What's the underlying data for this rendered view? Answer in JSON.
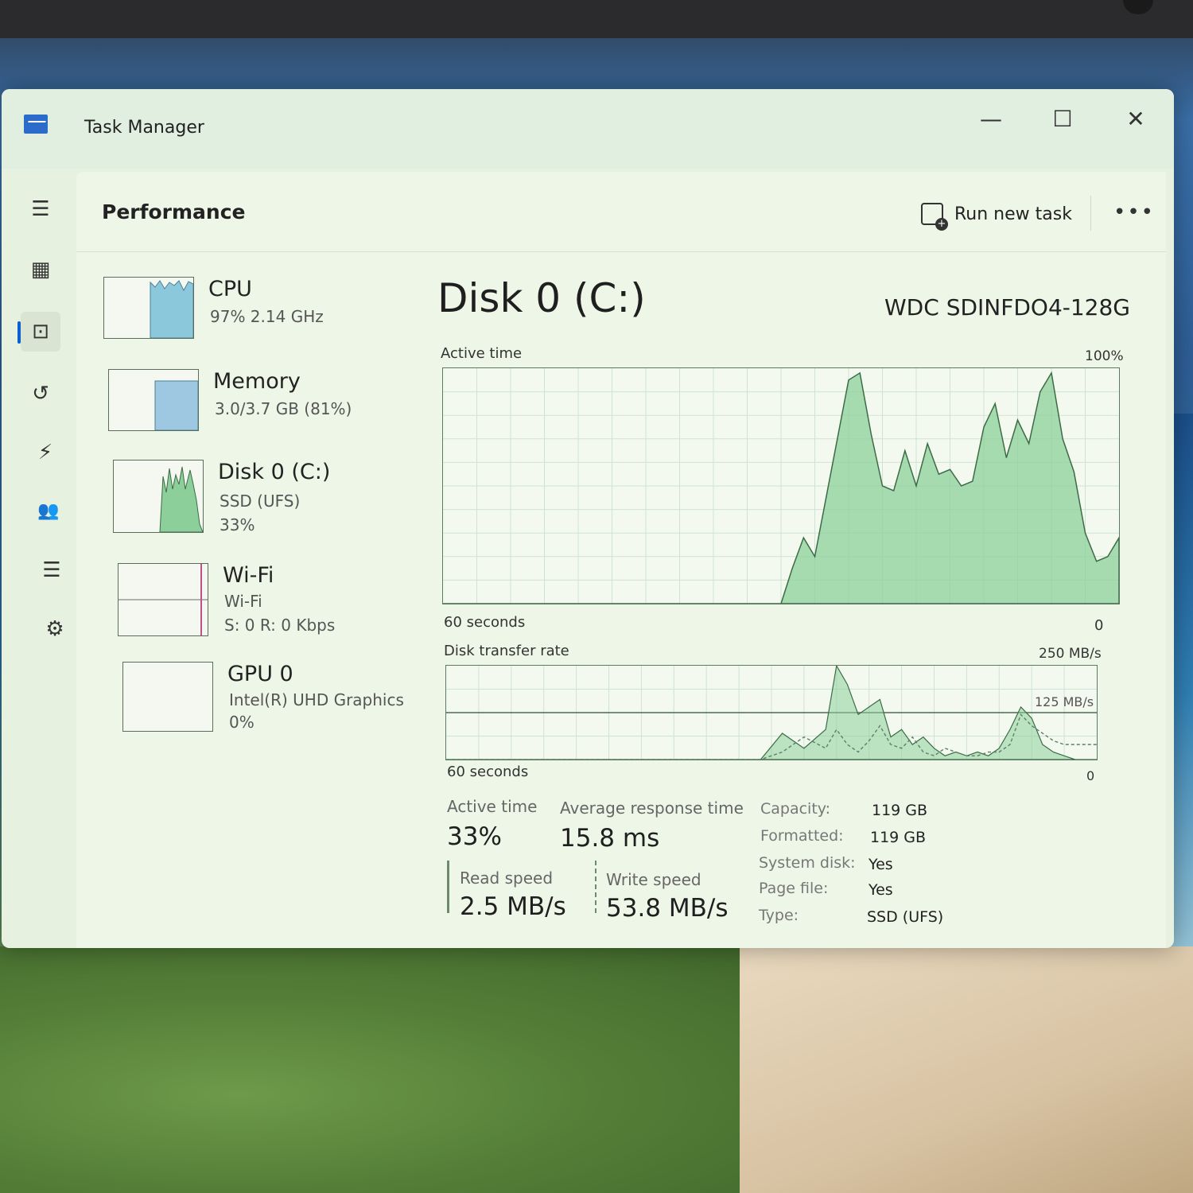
{
  "window": {
    "title": "Task Manager",
    "minimize": "—",
    "maximize": "☐",
    "close": "✕"
  },
  "nav": [
    {
      "name": "hamburger-menu-icon",
      "glyph": "☰"
    },
    {
      "name": "processes-icon",
      "glyph": "▦"
    },
    {
      "name": "performance-icon",
      "glyph": "⊡"
    },
    {
      "name": "app-history-icon",
      "glyph": "↺"
    },
    {
      "name": "startup-apps-icon",
      "glyph": "⚡"
    },
    {
      "name": "users-icon",
      "glyph": "👥"
    },
    {
      "name": "details-icon",
      "glyph": "☰"
    },
    {
      "name": "services-icon",
      "glyph": "⚙"
    }
  ],
  "header": {
    "title": "Performance",
    "run_task": "Run new task",
    "more": "•••"
  },
  "devices": [
    {
      "name": "CPU",
      "line1": "97%  2.14 GHz",
      "line2": "",
      "usage": 0.97
    },
    {
      "name": "Memory",
      "line1": "3.0/3.7 GB (81%)",
      "line2": "",
      "usage": 0.81
    },
    {
      "name": "Disk 0 (C:)",
      "line1": "SSD (UFS)",
      "line2": "33%",
      "usage": 0.33
    },
    {
      "name": "Wi-Fi",
      "line1": "Wi-Fi",
      "line2": "S: 0  R: 0 Kbps",
      "usage": 0
    },
    {
      "name": "GPU 0",
      "line1": "Intel(R) UHD Graphics",
      "line2": "0%",
      "usage": 0
    }
  ],
  "detail": {
    "title": "Disk 0 (C:)",
    "model": "WDC SDINFDO4-128G",
    "active_label": "Active time",
    "active_max": "100%",
    "active_left": "60 seconds",
    "active_right": "0",
    "rate_label": "Disk transfer rate",
    "rate_max": "250 MB/s",
    "rate_mid": "125 MB/s",
    "rate_left": "60 seconds",
    "rate_right": "0"
  },
  "stats": {
    "active_time_label": "Active time",
    "active_time_value": "33%",
    "response_label": "Average response time",
    "response_value": "15.8 ms",
    "read_label": "Read speed",
    "read_value": "2.5 MB/s",
    "write_label": "Write speed",
    "write_value": "53.8 MB/s"
  },
  "props": [
    {
      "label": "Capacity:",
      "value": "119 GB"
    },
    {
      "label": "Formatted:",
      "value": "119 GB"
    },
    {
      "label": "System disk:",
      "value": "Yes"
    },
    {
      "label": "Page file:",
      "value": "Yes"
    },
    {
      "label": "Type:",
      "value": "SSD (UFS)"
    }
  ],
  "chart_data": [
    {
      "type": "area",
      "title": "Active time",
      "ylim": [
        0,
        100
      ],
      "xlabel": "60 seconds",
      "x": [
        60,
        55,
        50,
        45,
        40,
        35,
        30,
        29,
        28,
        27,
        26,
        25,
        24,
        23,
        22,
        21,
        20,
        19,
        18,
        17,
        16,
        15,
        14,
        13,
        12,
        11,
        10,
        9,
        8,
        7,
        6,
        5,
        4,
        3,
        2,
        1,
        0
      ],
      "values": [
        0,
        0,
        0,
        0,
        0,
        0,
        0,
        15,
        28,
        20,
        45,
        70,
        95,
        98,
        72,
        50,
        48,
        65,
        50,
        68,
        55,
        57,
        50,
        52,
        75,
        85,
        62,
        78,
        68,
        90,
        98,
        70,
        56,
        30,
        18,
        20,
        28
      ],
      "color": "#8ccf9a"
    },
    {
      "type": "area",
      "title": "Disk transfer rate",
      "ylim": [
        0,
        250
      ],
      "xlabel": "60 seconds",
      "series": [
        {
          "x": [
            60,
            40,
            31,
            29,
            27,
            25,
            24,
            23,
            22,
            21,
            20,
            19,
            18,
            17,
            16,
            15,
            14,
            13,
            12,
            11,
            10,
            9,
            8,
            7,
            6,
            5,
            4,
            3,
            2,
            1,
            0
          ],
          "values": [
            0,
            0,
            0,
            70,
            30,
            80,
            250,
            200,
            120,
            140,
            160,
            60,
            80,
            40,
            60,
            30,
            10,
            20,
            10,
            20,
            10,
            30,
            80,
            140,
            110,
            40,
            20,
            10,
            0,
            0,
            0
          ],
          "color": "#8ccf9a"
        },
        {
          "x": [
            60,
            40,
            31,
            29,
            27,
            25,
            24,
            23,
            22,
            21,
            20,
            19,
            18,
            17,
            16,
            15,
            14,
            13,
            12,
            11,
            10,
            9,
            8,
            7,
            6,
            5,
            4,
            3,
            2,
            1,
            0
          ],
          "values": [
            0,
            0,
            0,
            20,
            60,
            30,
            80,
            40,
            20,
            50,
            90,
            40,
            30,
            60,
            20,
            10,
            30,
            20,
            10,
            10,
            20,
            20,
            40,
            120,
            90,
            70,
            50,
            40,
            40,
            40,
            40
          ],
          "color": "#5f7f6a"
        }
      ]
    }
  ]
}
